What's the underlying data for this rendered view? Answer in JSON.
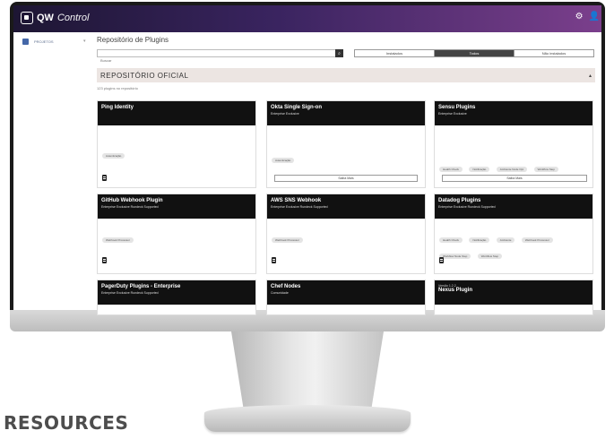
{
  "app": {
    "logo_qw": "QW",
    "logo_control": "Control"
  },
  "sidebar": {
    "items": [
      {
        "label": "PROJETOS"
      }
    ]
  },
  "page": {
    "title": "Repositório de Plugins",
    "search_placeholder": "Buscar"
  },
  "filters": [
    {
      "label": "Instalados"
    },
    {
      "label": "Todos"
    },
    {
      "label": "Não instalados"
    }
  ],
  "repo": {
    "title": "REPOSITÓRIO OFICIAL",
    "count": "123 plugins no repositório"
  },
  "cards": [
    {
      "name": "Ping Identity",
      "sub": "",
      "chips": [
        "Autenticação"
      ],
      "button": ""
    },
    {
      "name": "Okta Single Sign-on",
      "sub": "Enterprise Exclusive",
      "chips": [
        "Autenticação"
      ],
      "button": "Saiba Mais"
    },
    {
      "name": "Sensu Plugins",
      "sub": "Enterprise Exclusive",
      "chips": [
        "Health Check",
        "Notificação",
        "Ambiente Node Opt",
        "Workflow Step"
      ],
      "button": "Saiba Mais"
    },
    {
      "name": "GitHub Webhook Plugin",
      "sub": "Enterprise Exclusive Rundeck Supported",
      "chips": [
        "Webhook Processor"
      ],
      "button": ""
    },
    {
      "name": "AWS SNS Webhook",
      "sub": "Enterprise Exclusive Rundeck Supported",
      "chips": [
        "Webhook Processor"
      ],
      "button": ""
    },
    {
      "name": "Datadog Plugins",
      "sub": "Enterprise Exclusive Rundeck Supported",
      "chips": [
        "Health Check",
        "Notificação",
        "Ambiente",
        "Webhook Processor",
        "Workflow Node Step",
        "Workflow Step"
      ],
      "button": ""
    },
    {
      "name": "PagerDuty Plugins - Enterprise",
      "sub": "Enterprise Exclusive Rundeck Supported",
      "chips": [],
      "button": ""
    },
    {
      "name": "Chef Nodes",
      "sub": "Comunidade",
      "chips": [],
      "button": ""
    },
    {
      "name": "Nexus Plugin",
      "sub": "",
      "version": "Versão 1.2.2",
      "chips": [],
      "button": ""
    }
  ],
  "footer": {
    "label": "RESOURCES"
  }
}
